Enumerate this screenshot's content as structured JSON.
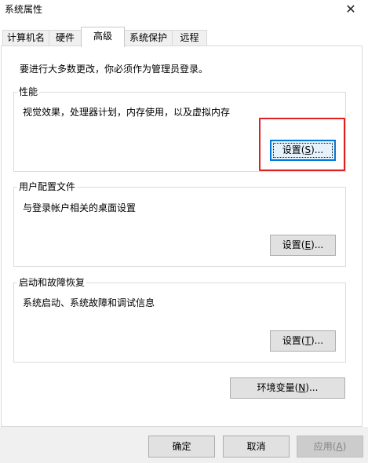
{
  "window": {
    "title": "系统属性",
    "close_symbol": "✕"
  },
  "tabs": [
    {
      "label": "计算机名",
      "active": false
    },
    {
      "label": "硬件",
      "active": false
    },
    {
      "label": "高级",
      "active": true
    },
    {
      "label": "系统保护",
      "active": false
    },
    {
      "label": "远程",
      "active": false
    }
  ],
  "admin_note": "要进行大多数更改，你必须作为管理员登录。",
  "performance": {
    "title": "性能",
    "description": "视觉效果，处理器计划，内存使用，以及虚拟内存",
    "button_label": "设置",
    "button_mnemonic": "S",
    "highlighted": true,
    "highlight_color": "#e02020"
  },
  "user_profiles": {
    "title": "用户配置文件",
    "description": "与登录帐户相关的桌面设置",
    "button_label": "设置",
    "button_mnemonic": "E"
  },
  "startup_recovery": {
    "title": "启动和故障恢复",
    "description": "系统启动、系统故障和调试信息",
    "button_label": "设置",
    "button_mnemonic": "T"
  },
  "env_vars": {
    "button_label": "环境变量",
    "button_mnemonic": "N"
  },
  "footer": {
    "ok_label": "确定",
    "cancel_label": "取消",
    "apply_label": "应用",
    "apply_mnemonic": "A",
    "apply_disabled": true
  },
  "colors": {
    "focus_border": "#0078d7",
    "button_face": "#e1e1e1",
    "disabled_face": "#cccccc"
  }
}
